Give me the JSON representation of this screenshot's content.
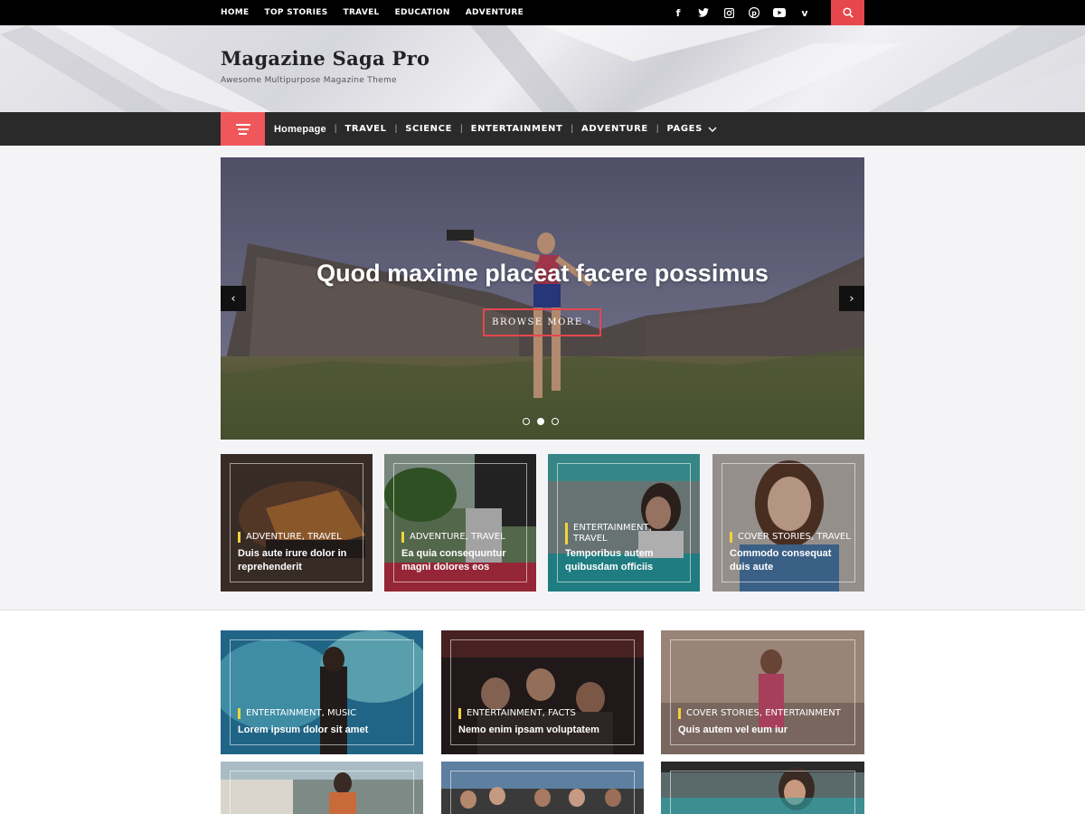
{
  "topbar": {
    "links": [
      "HOME",
      "TOP STORIES",
      "TRAVEL",
      "EDUCATION",
      "ADVENTURE"
    ],
    "social": [
      "facebook-icon",
      "twitter-icon",
      "instagram-icon",
      "pinterest-icon",
      "youtube-icon",
      "vimeo-icon"
    ],
    "accent": "#e6474d"
  },
  "header": {
    "title": "Magazine Saga Pro",
    "tagline": "Awesome Multipurpose Magazine Theme"
  },
  "mainnav": {
    "items": [
      "Homepage",
      "TRAVEL",
      "SCIENCE",
      "ENTERTAINMENT",
      "ADVENTURE",
      "PAGES"
    ],
    "accent": "#f0575b"
  },
  "slider": {
    "title": "Quod maxime placeat facere possimus",
    "button": "BROWSE MORE ›",
    "prev": "‹",
    "next": "›",
    "active_dot": 2,
    "dot_count": 3
  },
  "featured": [
    {
      "category": "ADVENTURE, TRAVEL",
      "title": "Duis aute irure dolor in reprehenderit"
    },
    {
      "category": "ADVENTURE, TRAVEL",
      "title": "Ea quia consequuntur magni dolores eos"
    },
    {
      "category": "ENTERTAINMENT, TRAVEL",
      "title": "Temporibus autem quibusdam officiis"
    },
    {
      "category": "COVER STORIES, TRAVEL",
      "title": "Commodo consequat duis aute"
    }
  ],
  "grid": [
    {
      "category": "ENTERTAINMENT, MUSIC",
      "title": "Lorem ipsum dolor sit amet"
    },
    {
      "category": "ENTERTAINMENT, FACTS",
      "title": "Nemo enim ipsam voluptatem"
    },
    {
      "category": "COVER STORIES, ENTERTAINMENT",
      "title": "Quis autem vel eum iur"
    }
  ]
}
